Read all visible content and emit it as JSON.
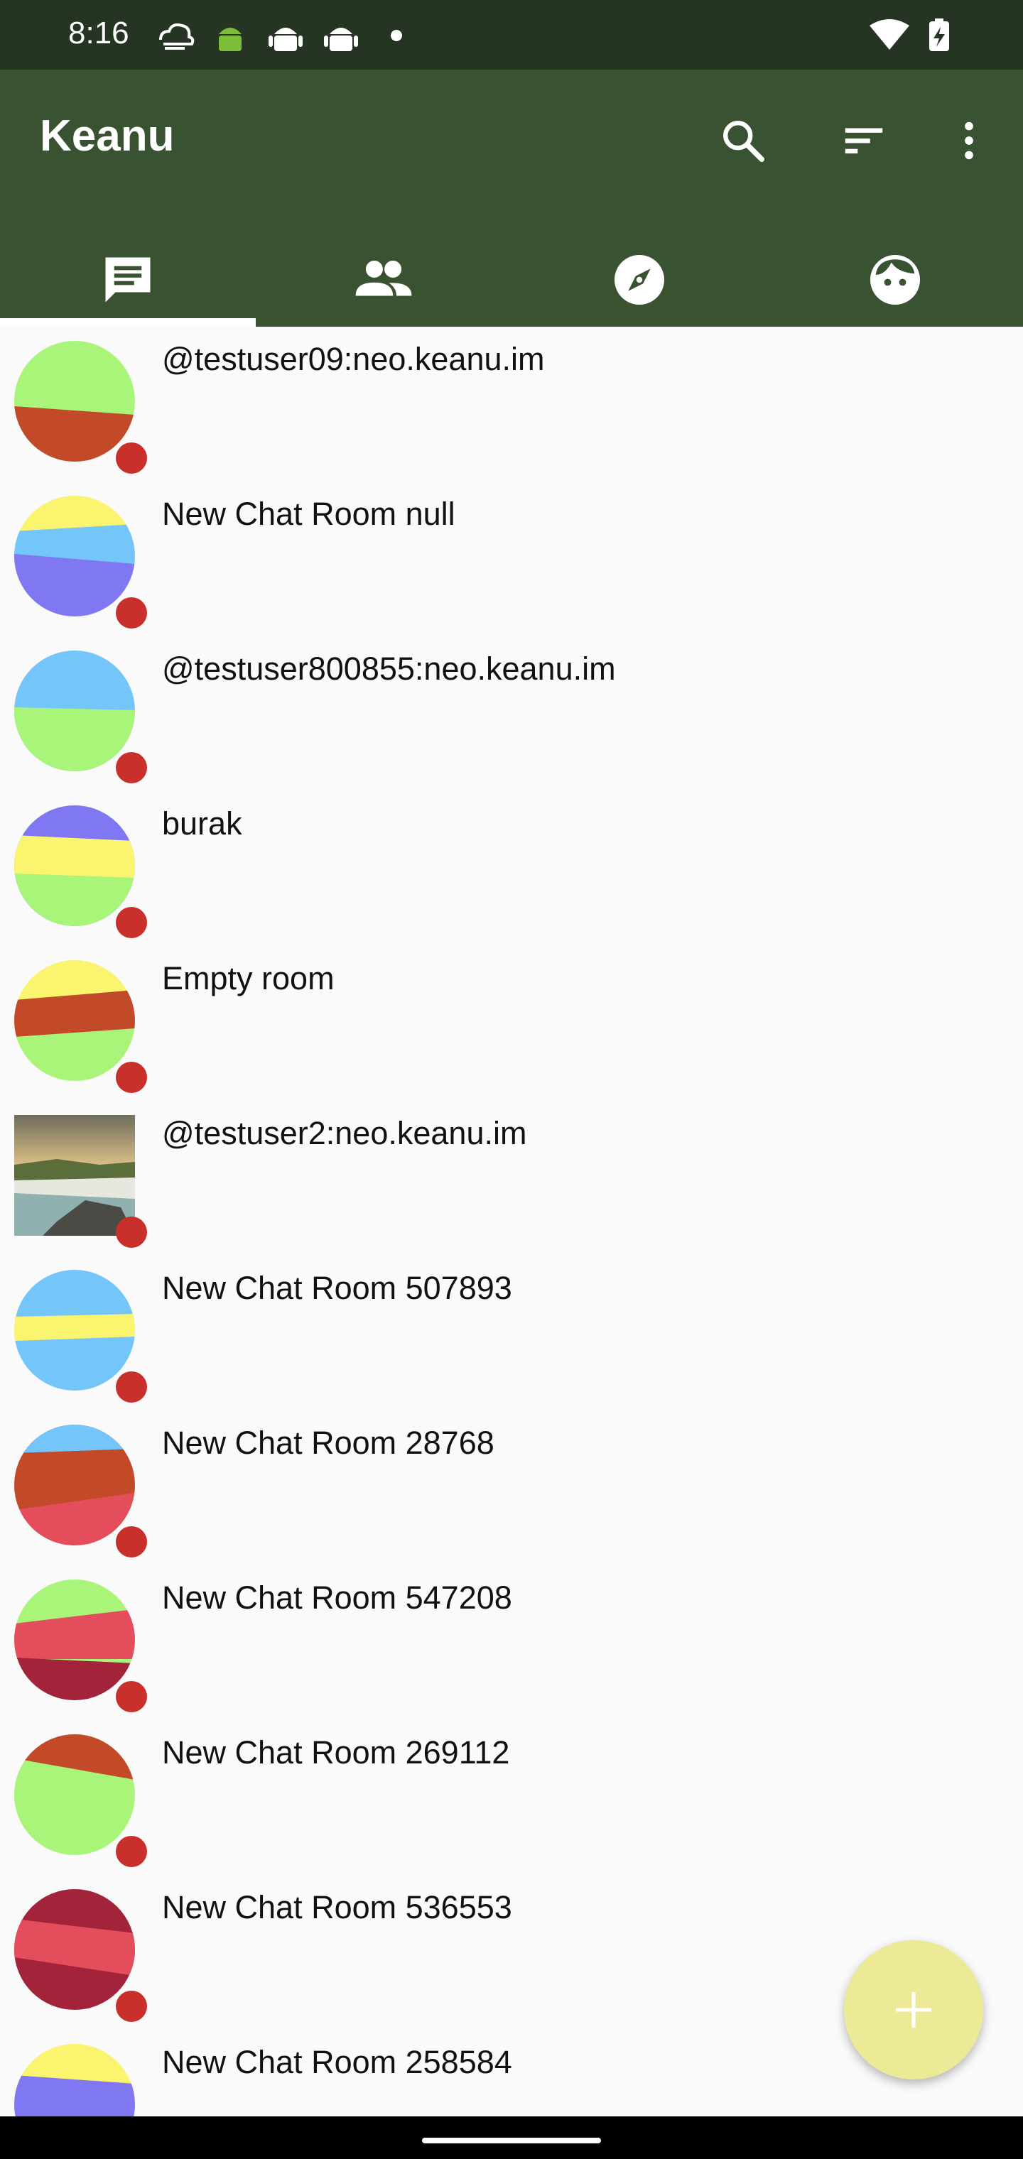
{
  "status_bar": {
    "time": "8:16",
    "left_icons": [
      "weather-cloud-icon",
      "android-icon",
      "android-icon",
      "android-icon",
      "dot-icon"
    ],
    "right_icons": [
      "wifi-icon",
      "battery-charging-icon"
    ]
  },
  "app_bar": {
    "title": "Keanu",
    "background": "#395231",
    "actions": [
      "search-icon",
      "sort-icon",
      "more-vert-icon"
    ]
  },
  "tabs": [
    {
      "name": "chats",
      "icon": "chat-icon",
      "selected": true
    },
    {
      "name": "contacts",
      "icon": "people-icon",
      "selected": false
    },
    {
      "name": "explore",
      "icon": "compass-icon",
      "selected": false
    },
    {
      "name": "profile",
      "icon": "face-icon",
      "selected": false
    }
  ],
  "rooms": [
    {
      "title": "@testuser09:neo.keanu.im"
    },
    {
      "title": "New Chat Room null"
    },
    {
      "title": "@testuser800855:neo.keanu.im"
    },
    {
      "title": "burak"
    },
    {
      "title": "Empty room"
    },
    {
      "title": "@testuser2:neo.keanu.im"
    },
    {
      "title": "New Chat Room 507893"
    },
    {
      "title": "New Chat Room 28768"
    },
    {
      "title": "New Chat Room 547208"
    },
    {
      "title": "New Chat Room 269112"
    },
    {
      "title": "New Chat Room 536553"
    },
    {
      "title": "New Chat Room 258584"
    }
  ],
  "colors": {
    "status_dot": "#c9302c",
    "fab": "#ecea97",
    "lime": "#a8f57a",
    "rust": "#c24a28",
    "yellow": "#fbf46f",
    "sky": "#73c5fa",
    "violet": "#8078f2",
    "coral": "#e34d5c",
    "crimson": "#a3243a"
  },
  "fab": {
    "icon": "add-icon"
  }
}
